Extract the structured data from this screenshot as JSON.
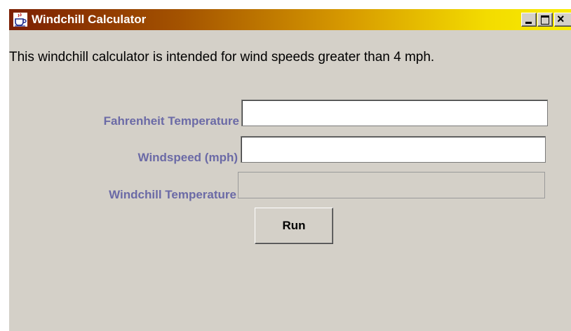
{
  "window": {
    "title": "Windchill Calculator",
    "app_icon": "java-coffee-cup-icon",
    "controls": {
      "minimize": "minimize-icon",
      "maximize": "maximize-icon",
      "close": "close-icon",
      "close_glyph": "×"
    }
  },
  "intro_text": "This windchill calculator is intended for wind speeds greater than 4 mph.",
  "form": {
    "fahrenheit_label": "Fahrenheit Temperature",
    "fahrenheit_value": "",
    "windspeed_label": "Windspeed (mph)",
    "windspeed_value": "",
    "windchill_label": "Windchill Temperature",
    "windchill_value": ""
  },
  "run_button_label": "Run",
  "colors": {
    "window_background": "#d4d0c8",
    "label_color": "#6b6aa6",
    "title_gradient_start": "#7b1f02",
    "title_gradient_end": "#f8ec00"
  }
}
